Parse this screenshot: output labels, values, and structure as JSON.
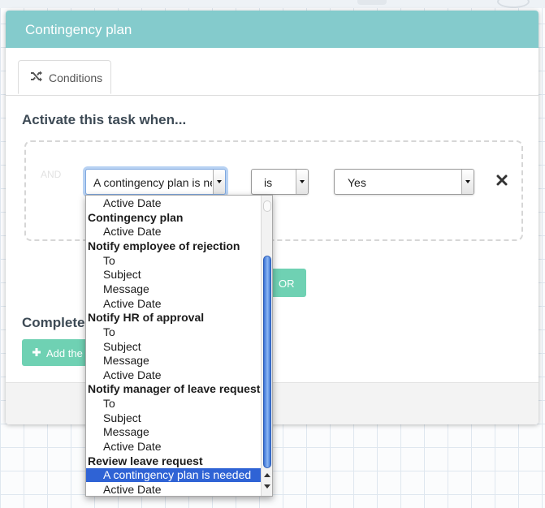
{
  "modal": {
    "title": "Contingency plan",
    "tab_label": "Conditions",
    "activate_heading": "Activate this task when...",
    "complete_heading": "Complete",
    "or_button": "OR",
    "add_button": "Add the"
  },
  "condition": {
    "field_value": "A contingency plan is needed",
    "operator_value": "is",
    "answer_value": "Yes"
  },
  "dropdown": {
    "items": [
      {
        "label": "Active Date",
        "kind": "option"
      },
      {
        "label": "Contingency plan",
        "kind": "group"
      },
      {
        "label": "Active Date",
        "kind": "option"
      },
      {
        "label": "Notify employee of rejection",
        "kind": "group"
      },
      {
        "label": "To",
        "kind": "option"
      },
      {
        "label": "Subject",
        "kind": "option"
      },
      {
        "label": "Message",
        "kind": "option"
      },
      {
        "label": "Active Date",
        "kind": "option"
      },
      {
        "label": "Notify HR of approval",
        "kind": "group"
      },
      {
        "label": "To",
        "kind": "option"
      },
      {
        "label": "Subject",
        "kind": "option"
      },
      {
        "label": "Message",
        "kind": "option"
      },
      {
        "label": "Active Date",
        "kind": "option"
      },
      {
        "label": "Notify manager of leave request",
        "kind": "group"
      },
      {
        "label": "To",
        "kind": "option"
      },
      {
        "label": "Subject",
        "kind": "option"
      },
      {
        "label": "Message",
        "kind": "option"
      },
      {
        "label": "Active Date",
        "kind": "option"
      },
      {
        "label": "Review leave request",
        "kind": "group"
      },
      {
        "label": "A contingency plan is needed",
        "kind": "option",
        "selected": true
      },
      {
        "label": "Active Date",
        "kind": "option"
      }
    ]
  },
  "icons": {
    "tab": "shuffle-icon",
    "remove": "close-icon",
    "add": "plus-icon",
    "or": "plus-icon"
  },
  "colors": {
    "header": "#84cbcc",
    "button": "#6fd1b3",
    "selection": "#2f63d5"
  }
}
